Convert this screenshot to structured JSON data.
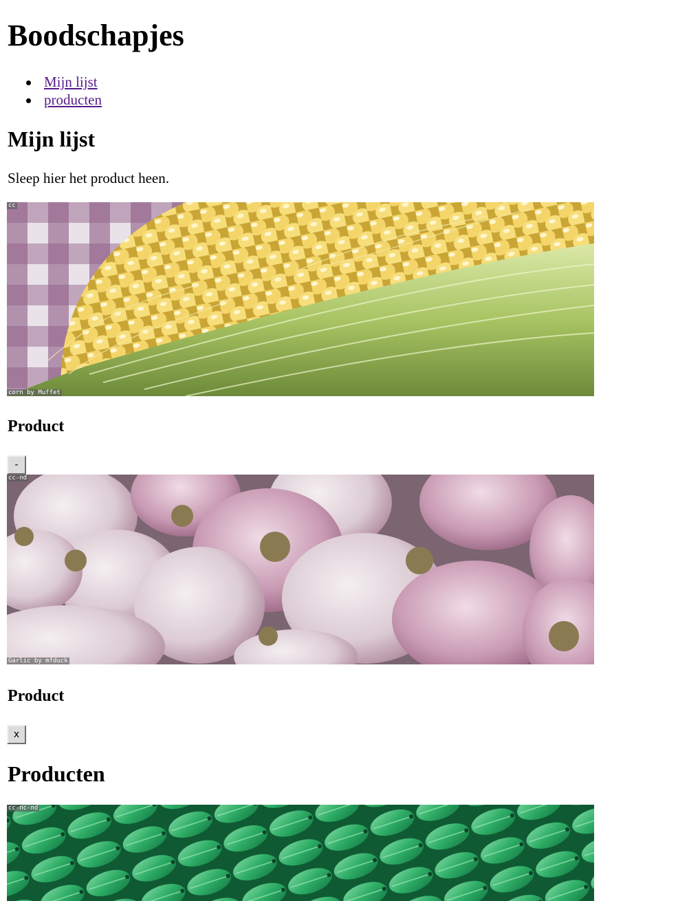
{
  "header": {
    "title": "Boodschapjes"
  },
  "nav": {
    "items": [
      {
        "label": "Mijn lijst"
      },
      {
        "label": "producten"
      }
    ]
  },
  "my_list": {
    "heading": "Mijn lijst",
    "hint": "Sleep hier het product heen.",
    "items": [
      {
        "license": "cc",
        "credit": "corn by Muffet",
        "title": "Product",
        "button": "-"
      },
      {
        "license": "cc-nd",
        "credit": "Garlic by mfduck",
        "title": "Product",
        "button": "x"
      }
    ]
  },
  "products": {
    "heading": "Producten",
    "items": [
      {
        "license": "cc-nc-nd"
      }
    ]
  },
  "colors": {
    "link": "#551a8b",
    "button_bg": "#dcdcdc",
    "text": "#000000"
  }
}
